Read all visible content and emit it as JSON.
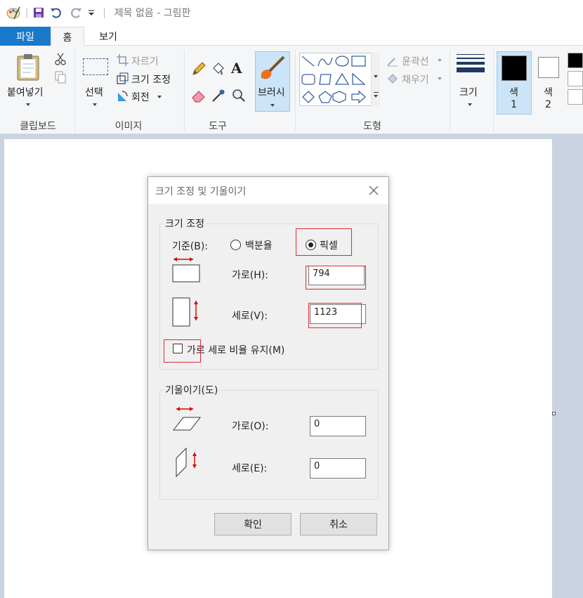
{
  "window": {
    "title": "제목 없음 - 그림판",
    "separator": "|"
  },
  "tabs": {
    "file": "파일",
    "home": "홈",
    "view": "보기"
  },
  "ribbon": {
    "clipboard": {
      "paste": "붙여넣기",
      "group": "클립보드"
    },
    "image": {
      "select": "선택",
      "crop": "자르기",
      "resize": "크기 조정",
      "rotate": "회전",
      "group": "이미지"
    },
    "tools": {
      "text_glyph": "A",
      "group": "도구"
    },
    "brushes": {
      "label": "브러시"
    },
    "shapes": {
      "outline": "윤곽선",
      "fill": "채우기",
      "group": "도형"
    },
    "size": {
      "label": "크기"
    },
    "colors": {
      "color1_label": "색",
      "color1_num": "1",
      "color2_label": "색",
      "color2_num": "2",
      "color1": "#000000",
      "color2": "#ffffff"
    }
  },
  "dialog": {
    "title": "크기 조정 및 기울이기",
    "resize": {
      "legend": "크기 조정",
      "basis_label": "기준(B):",
      "percent_option": "백분율",
      "pixel_option": "픽셀",
      "selected": "pixel",
      "horizontal_label": "가로(H):",
      "horizontal_value": "794",
      "vertical_label": "세로(V):",
      "vertical_value": "1123",
      "aspect_label": "가로 세로 비율 유지(M)",
      "aspect_checked": false
    },
    "skew": {
      "legend": "기울이기(도)",
      "horizontal_label": "가로(O):",
      "horizontal_value": "0",
      "vertical_label": "세로(E):",
      "vertical_value": "0"
    },
    "ok": "확인",
    "cancel": "취소"
  },
  "highlight_color": "#e0282e",
  "accent_color": "#1979ca"
}
